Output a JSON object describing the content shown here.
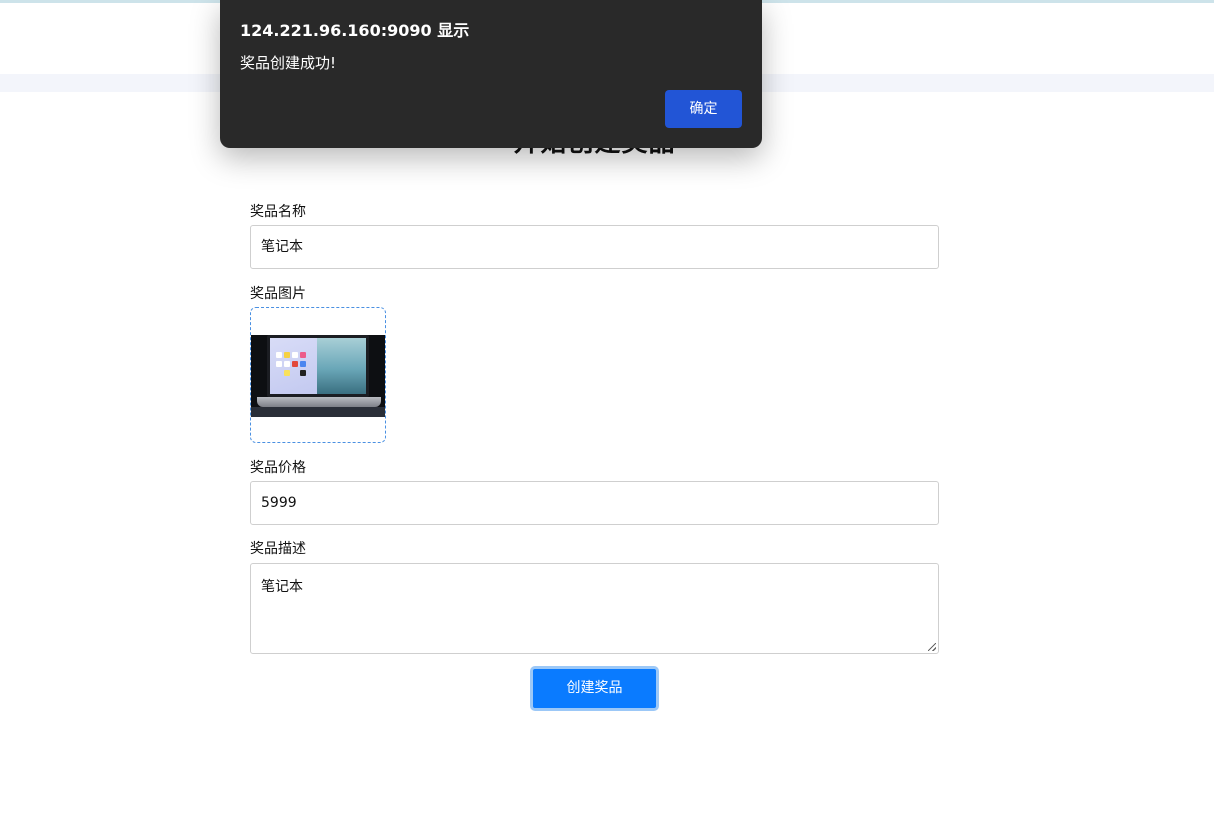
{
  "dialog": {
    "title": "124.221.96.160:9090 显示",
    "message": "奖品创建成功!",
    "ok_label": "确定"
  },
  "page": {
    "title": "开始创建奖品"
  },
  "form": {
    "name_label": "奖品名称",
    "name_value": "笔记本",
    "image_label": "奖品图片",
    "image_icon": "laptop-image",
    "price_label": "奖品价格",
    "price_value": "5999",
    "description_label": "奖品描述",
    "description_value": "笔记本",
    "submit_label": "创建奖品"
  },
  "colors": {
    "primary_button": "#0a7bff",
    "dialog_background": "#292929",
    "dialog_button": "#2255d6",
    "upload_border": "#4a90e2"
  }
}
